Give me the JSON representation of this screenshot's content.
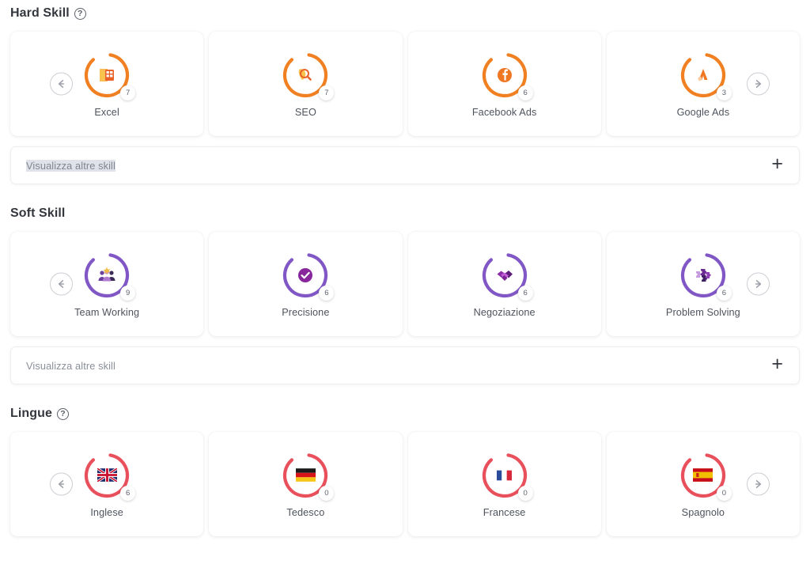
{
  "sections": [
    {
      "id": "hard-skill",
      "title": "Hard Skill",
      "has_help": true,
      "help_glyph": "?",
      "accent": "#f08021",
      "nav": {
        "prev": "arrow-left",
        "next": "arrow-right"
      },
      "cards": [
        {
          "label": "Excel",
          "value": "7",
          "icon": "excel-icon"
        },
        {
          "label": "SEO",
          "value": "7",
          "icon": "seo-magnifier-icon"
        },
        {
          "label": "Facebook Ads",
          "value": "6",
          "icon": "facebook-icon"
        },
        {
          "label": "Google Ads",
          "value": "3",
          "icon": "google-ads-icon"
        }
      ],
      "more_bar": {
        "label": "Visualizza altre skill",
        "selected": true,
        "add_label": "+"
      }
    },
    {
      "id": "soft-skill",
      "title": "Soft Skill",
      "has_help": false,
      "help_glyph": "?",
      "accent": "#8157c6",
      "nav": {
        "prev": "arrow-left",
        "next": "arrow-right"
      },
      "cards": [
        {
          "label": "Team Working",
          "value": "9",
          "icon": "team-working-icon"
        },
        {
          "label": "Precisione",
          "value": "6",
          "icon": "check-circle-icon"
        },
        {
          "label": "Negoziazione",
          "value": "6",
          "icon": "handshake-icon"
        },
        {
          "label": "Problem Solving",
          "value": "6",
          "icon": "puzzle-icon"
        }
      ],
      "more_bar": {
        "label": "Visualizza altre skill",
        "selected": false,
        "add_label": "+"
      }
    },
    {
      "id": "lingue",
      "title": "Lingue",
      "has_help": true,
      "help_glyph": "?",
      "accent": "#e8505b",
      "nav": {
        "prev": "arrow-left",
        "next": "arrow-right"
      },
      "cards": [
        {
          "label": "Inglese",
          "value": "6",
          "icon": "flag-uk-icon"
        },
        {
          "label": "Tedesco",
          "value": "0",
          "icon": "flag-germany-icon"
        },
        {
          "label": "Francese",
          "value": "0",
          "icon": "flag-france-icon"
        },
        {
          "label": "Spagnolo",
          "value": "0",
          "icon": "flag-spain-icon"
        }
      ],
      "more_bar": null
    }
  ]
}
